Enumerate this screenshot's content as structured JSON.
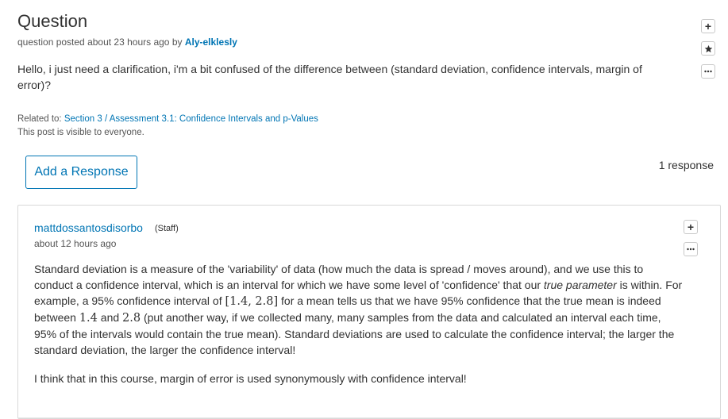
{
  "question": {
    "heading": "Question",
    "meta_prefix": "question posted about 23 hours ago by ",
    "author": "Aly-elklesly",
    "body": "Hello, i just need a clarification, i'm a bit confused of the difference between (standard deviation, confidence intervals, margin of error)?",
    "related_prefix": "Related to: ",
    "related_link": "Section 3 / Assessment 3.1: Confidence Intervals and p-Values",
    "visibility": "This post is visible to everyone."
  },
  "actions": {
    "add_response_label": "Add a Response",
    "response_count": "1 response"
  },
  "response": {
    "author": "mattdossantosdisorbo",
    "role": "(Staff)",
    "time": "about 12 hours ago",
    "p1_a": "Standard deviation is a measure of the 'variability' of data (how much the data is spread / moves around), and we use this to conduct a confidence interval, which is an interval for which we have some level of 'confidence' that our ",
    "p1_em": "true parameter",
    "p1_b": " is within. For example, a 95% confidence interval of ",
    "p1_math1": "[1.4, 2.8]",
    "p1_c": " for a mean tells us that we have 95% confidence that the true mean is indeed between ",
    "p1_math2": "1.4",
    "p1_d": " and ",
    "p1_math3": "2.8",
    "p1_e": " (put another way, if we collected many, many samples from the data and calculated an interval each time, 95% of the intervals would contain the true mean). Standard deviations are used to calculate the confidence interval; the larger the standard deviation, the larger the confidence interval!",
    "p2": "I think that in this course, margin of error is used synonymously with confidence interval!"
  },
  "colors": {
    "link": "#0075b4",
    "text": "#313131",
    "border": "#d9d9d9"
  }
}
